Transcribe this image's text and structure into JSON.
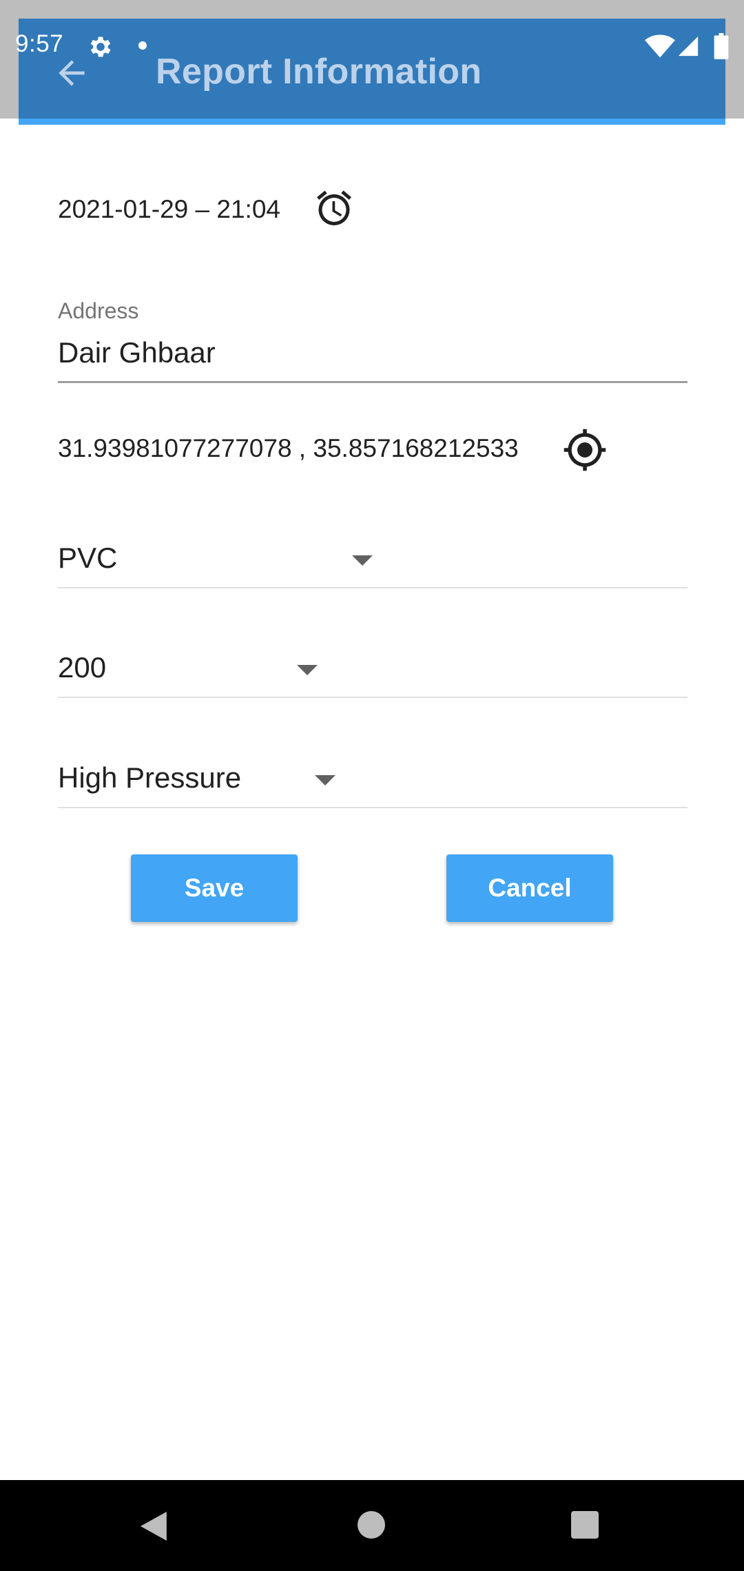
{
  "status_bar": {
    "time": "9:57",
    "icons": [
      "gear-icon",
      "notification-dot-icon",
      "wifi-icon",
      "signal-icon",
      "battery-icon"
    ]
  },
  "app_bar": {
    "title": "Report Information",
    "back_icon": "arrow-back-icon",
    "background_color": "#3179b9",
    "accent_color": "#42a5f5"
  },
  "form": {
    "datetime": "2021-01-29 – 21:04",
    "datetime_icon": "alarm-icon",
    "address_label": "Address",
    "address_value": "Dair Ghbaar",
    "coordinates": "31.93981077277078 , 35.857168212533",
    "coordinates_icon": "my-location-icon",
    "material_selected": "PVC",
    "size_selected": "200",
    "pressure_selected": "High Pressure"
  },
  "actions": {
    "save_label": "Save",
    "cancel_label": "Cancel",
    "button_color": "#42a5f5"
  },
  "nav_bar": {
    "icons": [
      "nav-back-icon",
      "nav-home-icon",
      "nav-recents-icon"
    ]
  }
}
